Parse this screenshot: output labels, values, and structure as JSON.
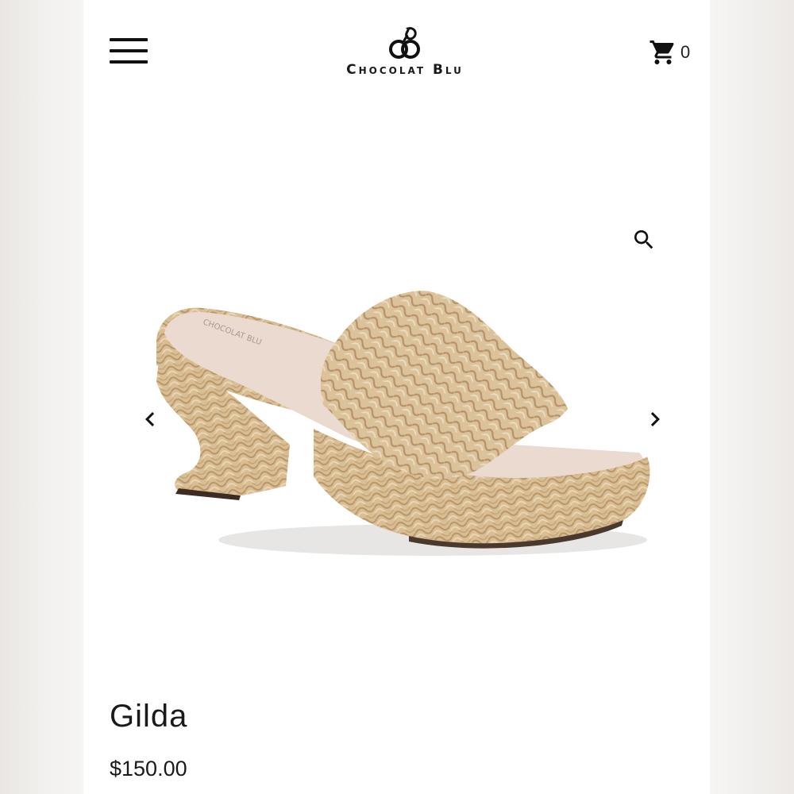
{
  "header": {
    "brand": "Chocolat Blu",
    "cart_count": "0",
    "icons": {
      "menu": "menu-icon",
      "cart": "cart-icon",
      "logo": "logo-mark"
    }
  },
  "gallery": {
    "icons": {
      "zoom": "search-icon",
      "prev": "chevron-left-icon",
      "next": "chevron-right-icon"
    },
    "image_label": "CHOCOLAT BLU"
  },
  "product": {
    "title": "Gilda",
    "price": "$150.00"
  },
  "colors": {
    "text": "#1a1a1a",
    "straw": "#d8bb90",
    "insole": "#ecdcd2"
  }
}
